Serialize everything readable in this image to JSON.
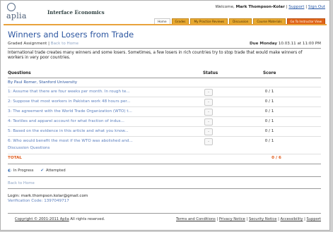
{
  "header": {
    "welcome_prefix": "Welcome,",
    "user_name": "Mark Thompson-Kolar",
    "support_label": "Support",
    "sign_out_label": "Sign Out",
    "logo_text": "aplia",
    "course_name": "Interface Economics"
  },
  "tabs": [
    {
      "label": "Home"
    },
    {
      "label": "Grades"
    },
    {
      "label": "My Practice Reviews"
    },
    {
      "label": "Discussion"
    },
    {
      "label": "Course Materials"
    },
    {
      "label": "Go To Instructor View"
    }
  ],
  "main": {
    "title": "Winners and Losers from Trade",
    "assignment_type": "Graded Assignment",
    "back_link": "Back to Home",
    "due_label": "Due Monday",
    "due_date": "10.03.11 at 11:00 PM",
    "intro": "International trade creates many winners and some losers. Sometimes, a few losers in rich countries try to stop trade that would make winners of workers in very poor countries."
  },
  "table": {
    "col_questions": "Questions",
    "col_status": "Status",
    "col_score": "Score",
    "author": "By Paul Romer, Stanford University",
    "rows": [
      {
        "q": "1: Assume that there are four weeks per month. In rough te...",
        "status": "-",
        "score": "0 / 1"
      },
      {
        "q": "2: Suppose that most workers in Pakistan work 48 hours per...",
        "status": "-",
        "score": "0 / 1"
      },
      {
        "q": "3: The agreement with the World Trade Organization (WTO) t...",
        "status": "-",
        "score": "0 / 1"
      },
      {
        "q": "4: Textiles and apparel account for what fraction of indus...",
        "status": "-",
        "score": "0 / 1"
      },
      {
        "q": "5: Based on the evidence in this article and what you know...",
        "status": "-",
        "score": "0 / 1"
      },
      {
        "q": "6: Who would benefit the most if the WTO was abolished and...",
        "status": "-",
        "score": "0 / 1"
      }
    ],
    "discussion": "Discussion Questions",
    "total_label": "TOTAL",
    "total_value": "0 / 6"
  },
  "legend": {
    "in_progress": "In Progress",
    "attempted": "Attempted"
  },
  "bottom": {
    "back_link": "Back to Home",
    "login": "Login: mark.thompson.kolar@gmail.com",
    "verification": "Verification Code: 1397049717"
  },
  "footer": {
    "copyright_link": "Copyright © 2001-2011 Aplia",
    "rights": "All rights reserved.",
    "links": [
      "Terms and Conditions",
      "Privacy Notice",
      "Security Notice",
      "Accessibility",
      "Support"
    ]
  },
  "colors": {
    "tab_orange": "#e7a930",
    "instructor_tab": "#e06418",
    "title_blue": "#2c56a0",
    "total_orange": "#e05a1a"
  }
}
